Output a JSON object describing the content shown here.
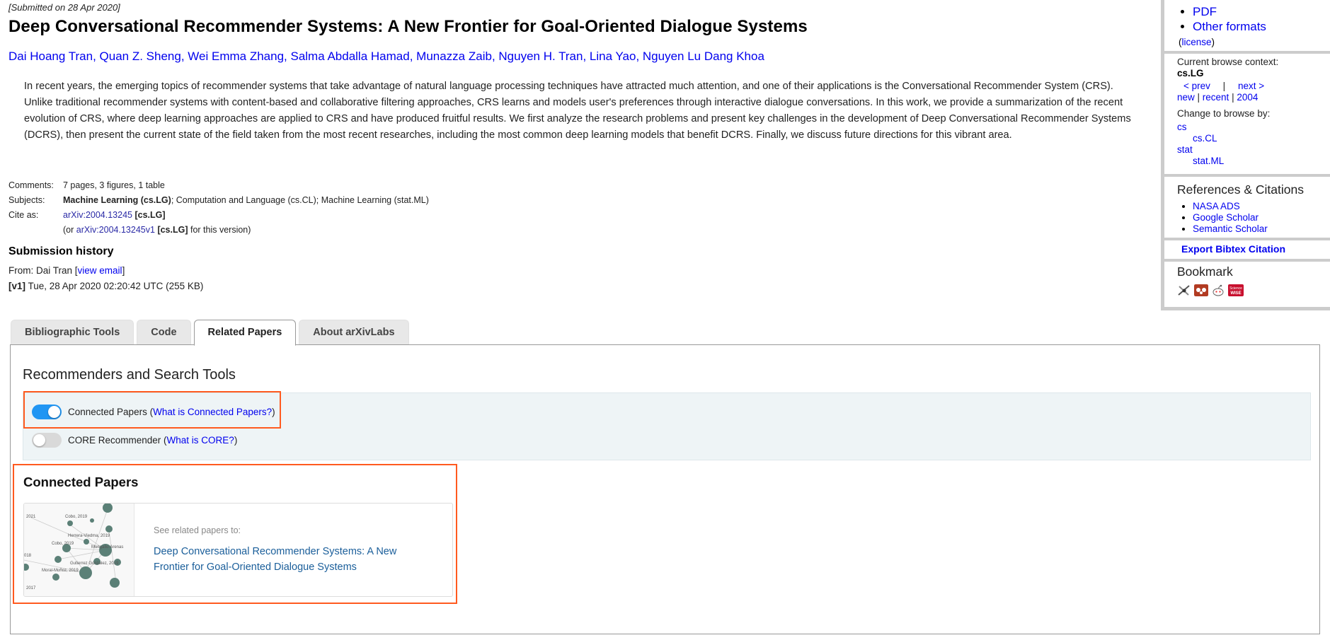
{
  "paper": {
    "dateline": "[Submitted on 28 Apr 2020]",
    "title": "Deep Conversational Recommender Systems: A New Frontier for Goal-Oriented Dialogue Systems",
    "authors": [
      "Dai Hoang Tran",
      "Quan Z. Sheng",
      "Wei Emma Zhang",
      "Salma Abdalla Hamad",
      "Munazza Zaib",
      "Nguyen H. Tran",
      "Lina Yao",
      "Nguyen Lu Dang Khoa"
    ],
    "abstract": "In recent years, the emerging topics of recommender systems that take advantage of natural language processing techniques have attracted much attention, and one of their applications is the Conversational Recommender System (CRS). Unlike traditional recommender systems with content-based and collaborative filtering approaches, CRS learns and models user's preferences through interactive dialogue conversations. In this work, we provide a summarization of the recent evolution of CRS, where deep learning approaches are applied to CRS and have produced fruitful results. We first analyze the research problems and present key challenges in the development of Deep Conversational Recommender Systems (DCRS), then present the current state of the field taken from the most recent researches, including the most common deep learning models that benefit DCRS. Finally, we discuss future directions for this vibrant area."
  },
  "meta": {
    "comments_label": "Comments:",
    "comments": "7 pages, 3 figures, 1 table",
    "subjects_label": "Subjects:",
    "subjects_primary": "Machine Learning (cs.LG)",
    "subjects_rest": "; Computation and Language (cs.CL); Machine Learning (stat.ML)",
    "cite_label": "Cite as:",
    "cite_id": "arXiv:2004.13245",
    "cite_cat": "[cs.LG]",
    "cite_alt_prefix": "(or ",
    "cite_alt_id": "arXiv:2004.13245v1",
    "cite_alt_cat": "[cs.LG]",
    "cite_alt_suffix": " for this version)"
  },
  "history": {
    "title": "Submission history",
    "from_prefix": "From: Dai Tran [",
    "view_email": "view email",
    "from_suffix": "]",
    "version_tag": "[v1]",
    "version_text": " Tue, 28 Apr 2020 02:20:42 UTC (255 KB)"
  },
  "sidebar": {
    "formats": [
      "PDF",
      "Other formats"
    ],
    "license_open": "(",
    "license": "license",
    "license_close": ")",
    "context_label": "Current browse context:",
    "context": "cs.LG",
    "prev": "< prev",
    "sep": "|",
    "next": "next >",
    "new": "new",
    "recent": "recent",
    "year": "2004",
    "change_label": "Change to browse by:",
    "browse": [
      {
        "label": "cs",
        "sub": "cs.CL"
      },
      {
        "label": "stat",
        "sub": "stat.ML"
      }
    ],
    "refs_title": "References & Citations",
    "refs": [
      "NASA ADS",
      "Google Scholar",
      "Semantic Scholar"
    ],
    "bibtex": "Export Bibtex Citation",
    "bookmark_title": "Bookmark",
    "bookmark_icons": [
      "bibsonomy-icon",
      "mendeley-icon",
      "reddit-icon",
      "sciencewise-icon"
    ],
    "sciencewise_text": "Science WISE"
  },
  "tabs": [
    {
      "label": "Bibliographic Tools",
      "active": false
    },
    {
      "label": "Code",
      "active": false
    },
    {
      "label": "Related Papers",
      "active": true
    },
    {
      "label": "About arXivLabs",
      "active": false
    }
  ],
  "panel": {
    "title": "Recommenders and Search Tools",
    "connected_papers": {
      "label": "Connected Papers (",
      "link": "What is Connected Papers?",
      "close": ")",
      "enabled": true
    },
    "core": {
      "label": "CORE Recommender (",
      "link": "What is CORE?",
      "close": ")",
      "enabled": false
    },
    "cp_section_title": "Connected Papers",
    "cp_see": "See related papers to:",
    "cp_link": "Deep Conversational Recommender Systems: A New Frontier for Goal-Oriented Dialogue Systems",
    "thumb_labels": [
      "2021",
      "Cobo, 2019",
      "Herrera-Viedma, 2019",
      "Cobo, 2019",
      "Mungallo-Arenas",
      "018",
      "Gutierrez Gonzalez, 2019",
      "Moral-Muñoz, 2019",
      "2017"
    ]
  },
  "colors": {
    "link": "#0000ee",
    "highlight": "#ff5a1f",
    "toggle_on": "#2196f3",
    "band": "#eef4f6"
  }
}
